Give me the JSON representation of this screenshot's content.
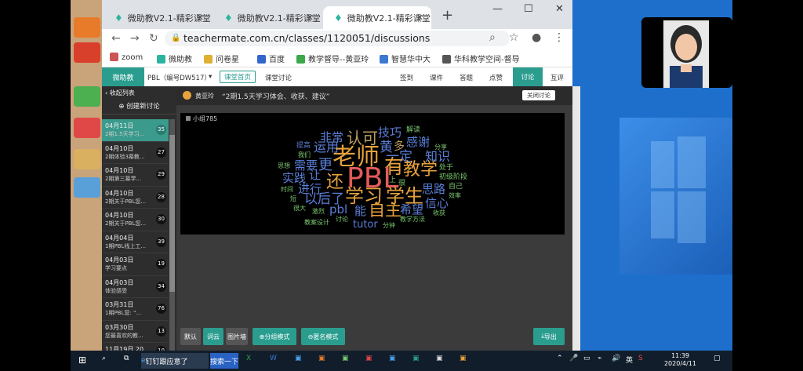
{
  "browser": {
    "tabs": [
      {
        "label": "微助教V2.1-精彩课堂"
      },
      {
        "label": "微助教V2.1-精彩课堂"
      },
      {
        "label": "微助教V2.1-精彩课堂"
      }
    ],
    "url": "teachermate.com.cn/classes/1120051/discussions",
    "bookmarks": [
      "zoom",
      "微助教",
      "问卷星",
      "百度",
      "教学督导--黄亚玲",
      "智慧华中大",
      "华科教学空间-督导"
    ]
  },
  "app": {
    "brand": "微助教",
    "course": "PBL（编号DW517）",
    "home_btn": "课堂首页",
    "discussion": "课堂讨论",
    "nav": [
      "签到",
      "课件",
      "答题",
      "点赞",
      "讨论",
      "互评"
    ],
    "active_nav": "讨论"
  },
  "sidebar": {
    "collapse": "收起列表",
    "create": "创建新讨论",
    "items": [
      {
        "date": "04月11日",
        "title": "2期1.5天学习...",
        "count": "35"
      },
      {
        "date": "04月10日",
        "title": "2期体验3幕教...",
        "count": "27"
      },
      {
        "date": "04月10日",
        "title": "2期第三幕学...",
        "count": "29"
      },
      {
        "date": "04月10日",
        "title": "2期关于PBL您...",
        "count": "28"
      },
      {
        "date": "04月10日",
        "title": "2期关于PBL您...",
        "count": "30"
      },
      {
        "date": "04月04日",
        "title": "1期PBL线上工...",
        "count": "39"
      },
      {
        "date": "04月03日",
        "title": "学习要点",
        "count": "19"
      },
      {
        "date": "04月03日",
        "title": "体验感受",
        "count": "34"
      },
      {
        "date": "03月31日",
        "title": "1期PBL营: “...",
        "count": "76"
      },
      {
        "date": "03月30日",
        "title": "您最喜欢的教...",
        "count": "13"
      },
      {
        "date": "11月19日 20...",
        "title": "",
        "count": "10"
      }
    ]
  },
  "topic": {
    "author": "黄亚玲",
    "text": "“2期1.5天学习体会、收获、建议”",
    "close": "关闭讨论"
  },
  "group": {
    "title": "小组785"
  },
  "bottom": {
    "default": "默认",
    "wordcloud": "词云",
    "imagewall": "图片墙",
    "group_mode": "分组模式",
    "anon_mode": "匿名模式",
    "export": "导出"
  },
  "taskbar": {
    "search": "搜索一下",
    "app1": "钉钉跟应意了",
    "ime": "英",
    "time": "11:39",
    "date": "2020/4/11"
  },
  "colors": {
    "accent": "#2a9d8f",
    "taskbar": "#111d2b"
  }
}
